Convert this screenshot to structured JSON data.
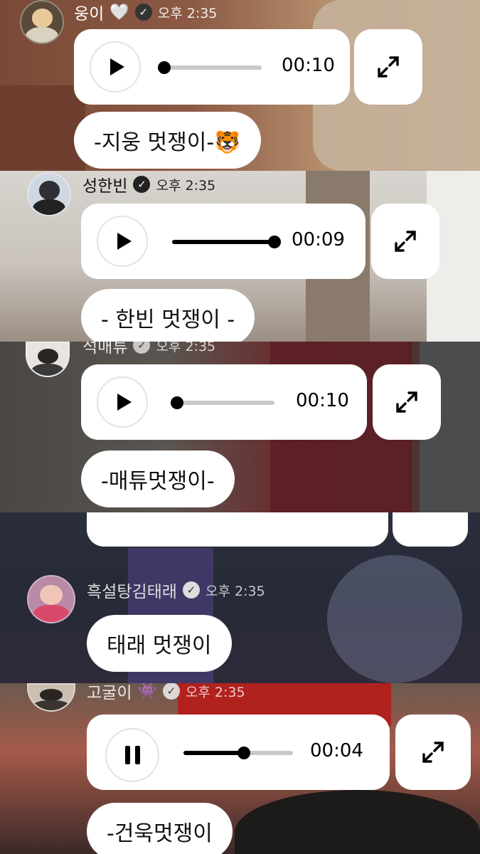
{
  "messages": [
    {
      "name": "웅이",
      "heart": "🤍",
      "time": "오후 2:35",
      "duration": "00:10",
      "progress": 0.05,
      "state": "paused",
      "caption": "-지웅 멋쟁이-🐯"
    },
    {
      "name": "성한빈",
      "time": "오후 2:35",
      "duration": "00:09",
      "progress": 1.0,
      "state": "paused",
      "caption": "- 한빈 멋쟁이 -"
    },
    {
      "name": "석매튜",
      "time": "오후 2:35",
      "duration": "00:10",
      "progress": 0.05,
      "state": "paused",
      "caption": "-매튜멋쟁이-"
    },
    {
      "name": "흑설탕김태래",
      "time": "오후 2:35",
      "caption": "태래 멋쟁이"
    },
    {
      "name": "고굴이",
      "emoji": "👾",
      "time": "오후 2:35",
      "duration": "00:04",
      "progress": 0.55,
      "state": "playing",
      "caption": "-건욱멋쟁이"
    }
  ],
  "icons": {
    "play": "play-icon",
    "pause": "pause-icon",
    "expand": "expand-icon",
    "verified": "verified-badge-icon"
  },
  "colors": {
    "bubble": "#ffffff",
    "accent": "#000000",
    "track": "#c9c9c9"
  }
}
